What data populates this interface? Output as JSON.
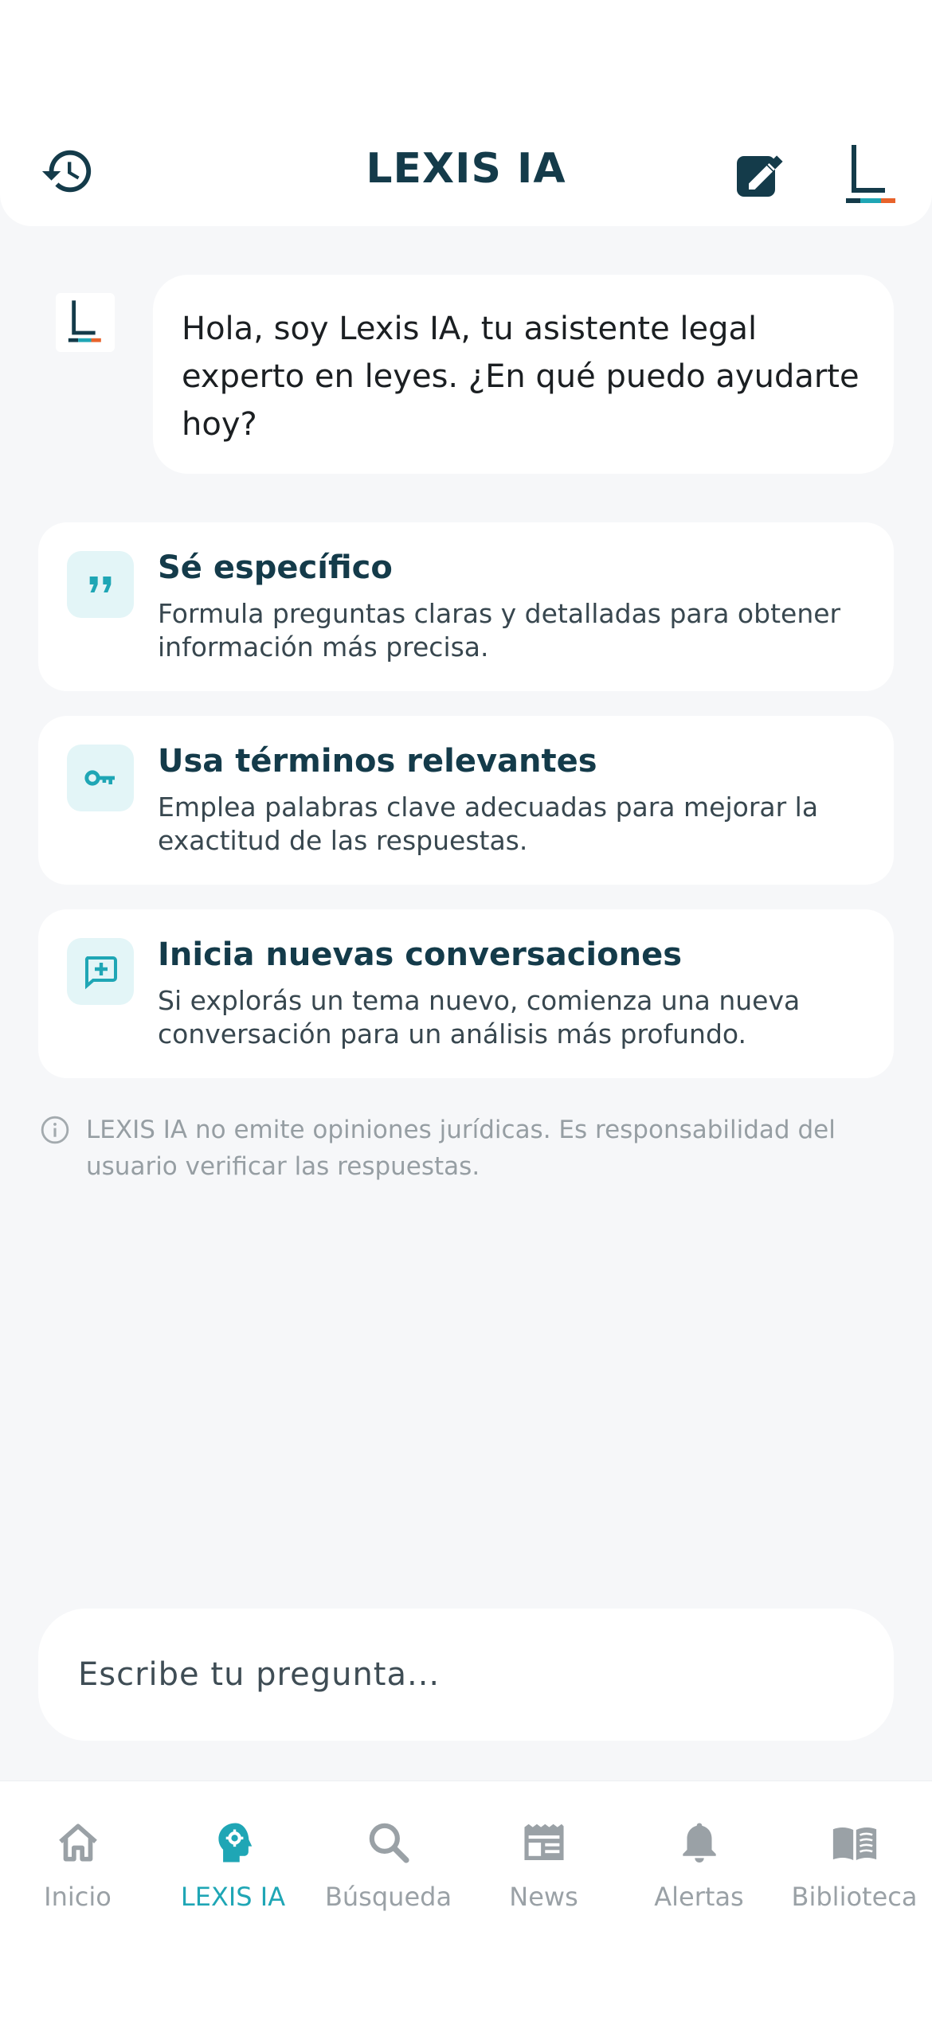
{
  "header": {
    "title": "LEXIS IA",
    "logo_letter": "L"
  },
  "chat": {
    "avatar_letter": "L",
    "greeting": "Hola, soy Lexis IA, tu asistente legal experto en leyes. ¿En qué puedo ayudarte hoy?"
  },
  "tips": [
    {
      "icon": "quote-icon",
      "title": "Sé específico",
      "description": "Formula preguntas claras y detalladas para obtener información más precisa."
    },
    {
      "icon": "key-icon",
      "title": "Usa términos relevantes",
      "description": "Emplea palabras clave adecuadas para mejorar la exactitud de las respuestas."
    },
    {
      "icon": "add-comment-icon",
      "title": "Inicia nuevas conversaciones",
      "description": "Si explorás un tema nuevo, comienza una nueva conversación para un análisis más profundo."
    }
  ],
  "disclaimer": "LEXIS IA no emite opiniones jurídicas. Es responsabilidad del usuario verificar las respuestas.",
  "composer": {
    "placeholder": "Escribe tu pregunta..."
  },
  "nav": [
    {
      "label": "Inicio",
      "icon": "home-icon",
      "active": false
    },
    {
      "label": "LEXIS IA",
      "icon": "ai-head-icon",
      "active": true
    },
    {
      "label": "Búsqueda",
      "icon": "search-icon",
      "active": false
    },
    {
      "label": "News",
      "icon": "newspaper-icon",
      "active": false
    },
    {
      "label": "Alertas",
      "icon": "bell-icon",
      "active": false
    },
    {
      "label": "Biblioteca",
      "icon": "book-icon",
      "active": false
    }
  ],
  "colors": {
    "primary_dark": "#143b4a",
    "accent": "#1fa6b5",
    "accent_light": "#e3f5f7",
    "muted": "#9aa1a6",
    "background": "#f6f7f9",
    "logo_orange": "#e8632b",
    "logo_teal": "#1fa6b5"
  }
}
